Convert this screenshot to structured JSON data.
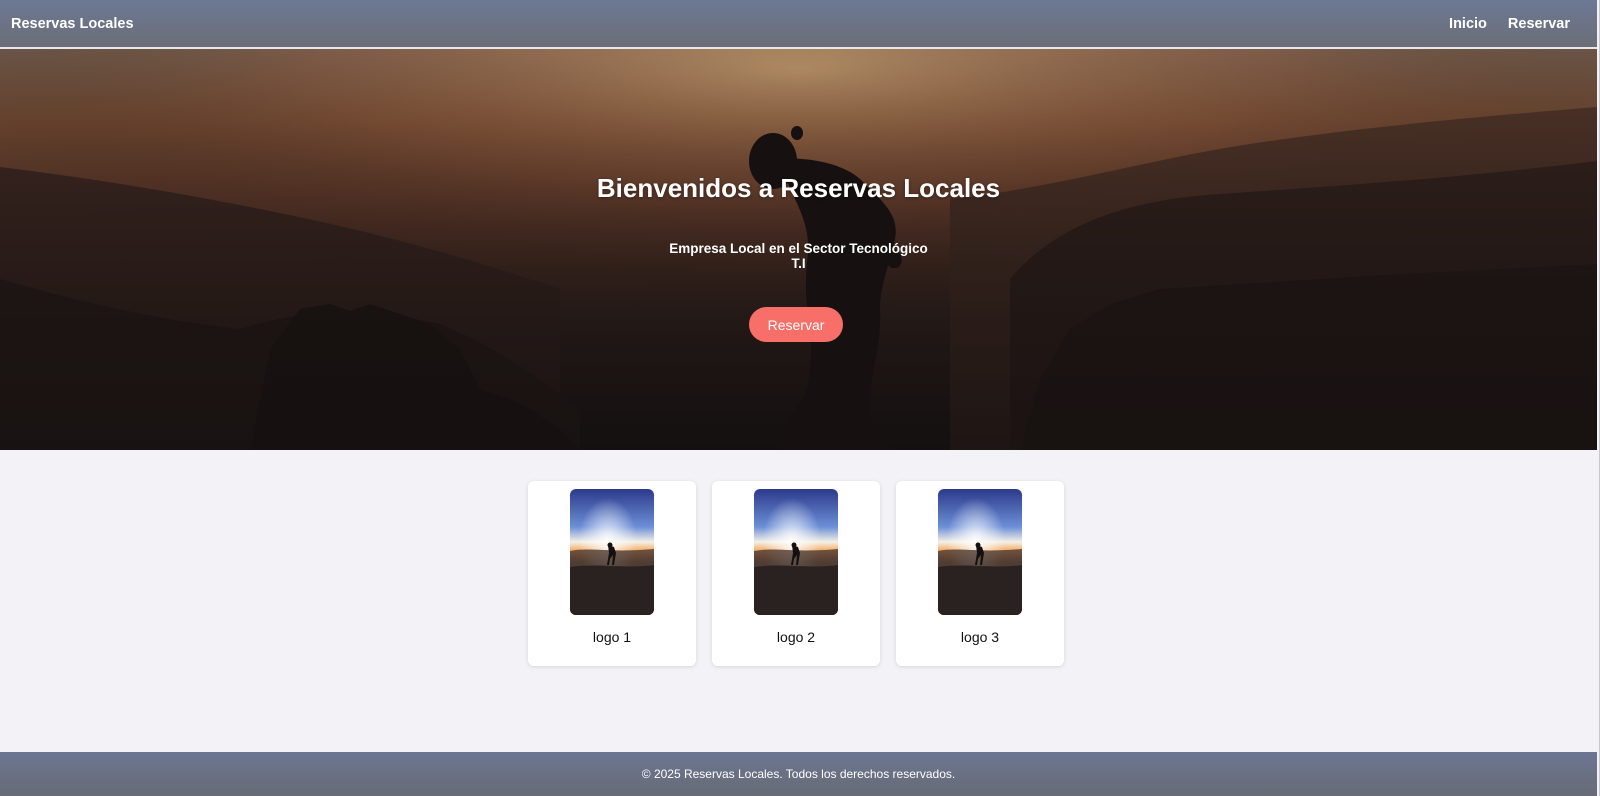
{
  "header": {
    "brand": "Reservas Locales",
    "nav": [
      {
        "label": "Inicio"
      },
      {
        "label": "Reservar"
      }
    ]
  },
  "hero": {
    "title": "Bienvenidos a Reservas Locales",
    "subtitle_line1": "Empresa Local en el Sector Tecnológico",
    "subtitle_line2": "T.I",
    "button_label": "Reservar"
  },
  "cards": [
    {
      "label": "logo 1"
    },
    {
      "label": "logo 2"
    },
    {
      "label": "logo 3"
    }
  ],
  "footer": {
    "text": "© 2025 Reservas Locales. Todos los derechos reservados."
  },
  "colors": {
    "header": "#6d7894",
    "accent_button": "#f86f6a",
    "page_background": "#f3f3f7",
    "footer": "#6c7692"
  }
}
